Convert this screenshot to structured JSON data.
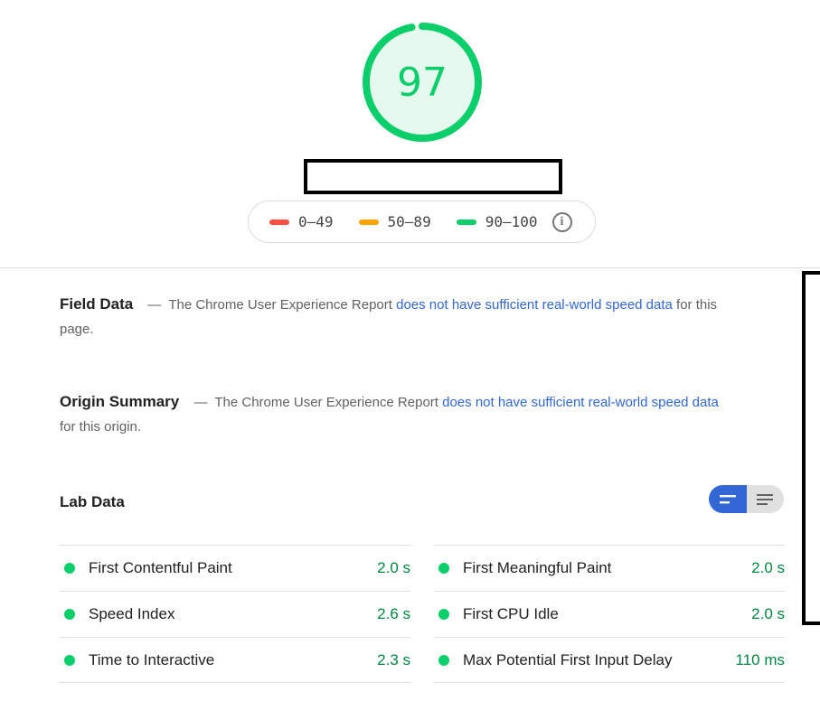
{
  "score": {
    "value": "97",
    "fraction": 0.97,
    "color": "#0cce6b",
    "bg_color": "#e6f9ef"
  },
  "legend": {
    "items": [
      {
        "label": "0–49",
        "color": "#ff4e42"
      },
      {
        "label": "50–89",
        "color": "#ffa400"
      },
      {
        "label": "90–100",
        "color": "#0cce6b"
      }
    ],
    "info_icon": "info-icon"
  },
  "field_data": {
    "title": "Field Data",
    "dash": "—",
    "text_before": "The Chrome User Experience Report",
    "link": "does not have sufficient real-world speed data",
    "text_after": "for this page."
  },
  "origin_summary": {
    "title": "Origin Summary",
    "dash": "—",
    "text_before": "The Chrome User Experience Report",
    "link": "does not have sufficient real-world speed data",
    "text_after": "for this origin."
  },
  "lab_data": {
    "title": "Lab Data",
    "toggle": {
      "active": "summary-view-icon",
      "inactive": "list-view-icon"
    },
    "metrics_left": [
      {
        "label": "First Contentful Paint",
        "value": "2.0 s"
      },
      {
        "label": "Speed Index",
        "value": "2.6 s"
      },
      {
        "label": "Time to Interactive",
        "value": "2.3 s"
      }
    ],
    "metrics_right": [
      {
        "label": "First Meaningful Paint",
        "value": "2.0 s"
      },
      {
        "label": "First CPU Idle",
        "value": "2.0 s"
      },
      {
        "label": "Max Potential First Input Delay",
        "value": "110 ms"
      }
    ]
  }
}
